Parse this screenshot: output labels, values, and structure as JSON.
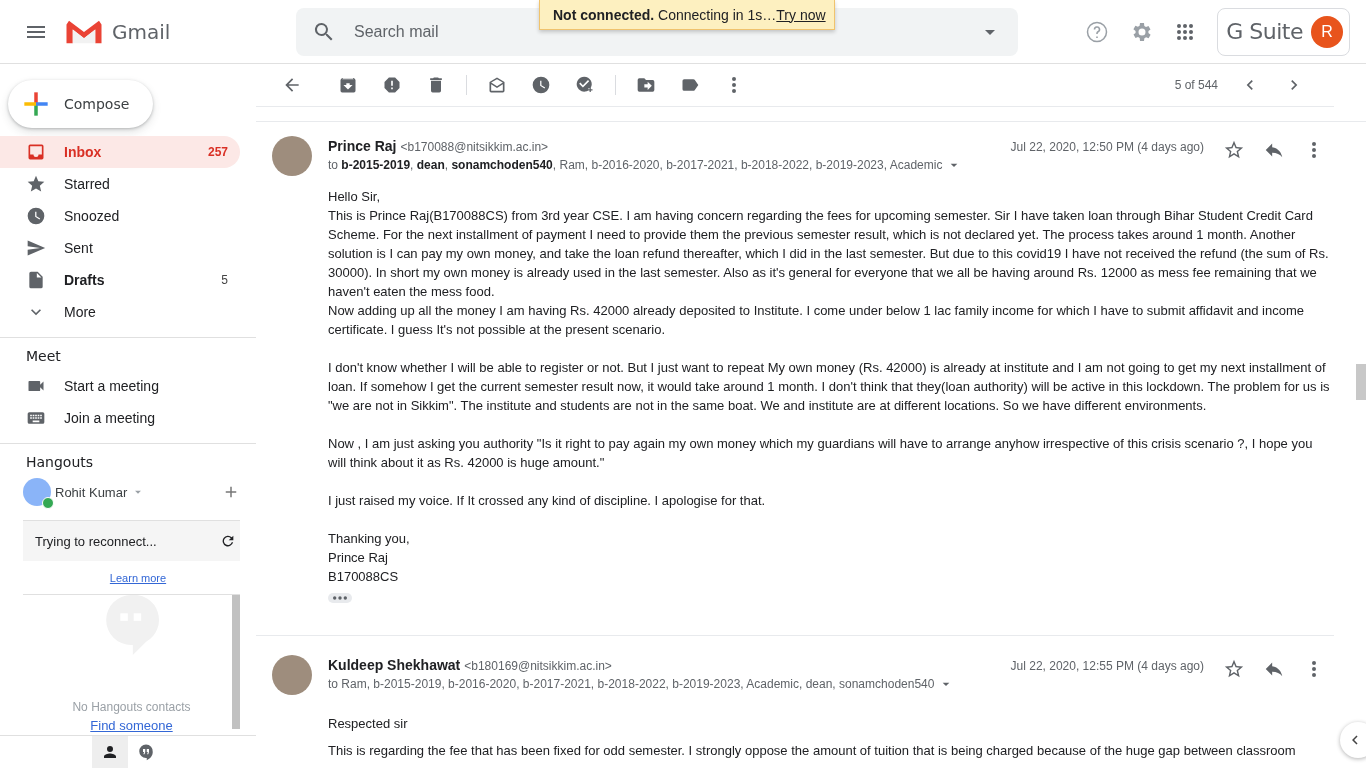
{
  "header": {
    "app_name": "Gmail",
    "search": {
      "placeholder": "Search mail"
    },
    "suite_label": "G Suite",
    "avatar_initial": "R"
  },
  "toast": {
    "message": "**Not connected.** Connecting in 1s…",
    "link": "Try now"
  },
  "compose": {
    "label": "Compose"
  },
  "sidebar": {
    "items": [
      {
        "label": "Inbox",
        "count": "257",
        "selected": true,
        "bold": true,
        "kind": "inbox"
      },
      {
        "label": "Starred",
        "selected": false,
        "bold": false,
        "kind": "star"
      },
      {
        "label": "Snoozed",
        "selected": false,
        "bold": false,
        "kind": "clock"
      },
      {
        "label": "Sent",
        "selected": false,
        "bold": false,
        "kind": "send"
      },
      {
        "label": "Drafts",
        "count": "5",
        "selected": false,
        "bold": true,
        "kind": "draft"
      },
      {
        "label": "More",
        "selected": false,
        "bold": false,
        "kind": "chevron"
      }
    ]
  },
  "meet": {
    "title": "Meet",
    "items": [
      {
        "label": "Start a meeting",
        "kind": "video"
      },
      {
        "label": "Join a meeting",
        "kind": "keyboard"
      }
    ]
  },
  "hangouts": {
    "title": "Hangouts",
    "user": "Rohit Kumar",
    "status": "Trying to reconnect...",
    "learn_more": "Learn more",
    "empty_text": "No Hangouts contacts",
    "find_link": "Find someone"
  },
  "toolbar": {
    "pager": "5 of 544"
  },
  "messages": [
    {
      "sender": "Prince Raj",
      "email": "<b170088@nitsikkim.ac.in>",
      "recipients": "to **b-2015-2019**, **dean**, **sonamchoden540**, Ram, b-2016-2020, b-2017-2021, b-2018-2022, b-2019-2023, Academic",
      "date": "Jul 22, 2020, 12:50 PM (4 days ago)",
      "blocks": [
        [
          "Hello Sir,",
          "This is Prince Raj(B170088CS) from 3rd year CSE. I am having concern regarding the fees for upcoming semester. Sir I have taken loan through Bihar Student Credit Card Scheme. For the next installment of payment I need to provide them the previous semester result, which is not declared yet. The process takes around 1 month. Another solution is I can pay my own money, and take the loan refund thereafter, which I did in the last semester. But due to this covid19 I have not received the refund (the sum of Rs. 30000). In short my own money is already used in the last semester. Also as it's general for everyone that we all be having around Rs. 12000 as mess fee remaining that we haven't eaten the mess food.",
          "Now adding up all the money I am having Rs. 42000 already deposited to Institute. I come under below 1 lac family income for which I have to submit affidavit and income certificate. I guess It's not possible at the present scenario."
        ],
        [
          "I don't know whether I will be able to register or not. But I just want to repeat My own money (Rs. 42000) is already at institute and I am not going to get my next installment of loan. If somehow I get the current semester result now, it would take around 1 month. I don't think that they(loan authority) will be active in this lockdown. The problem for us is \"we are not in Sikkim\". The institute and students are not in the same boat. We and institute are at different locations. So we have different environments."
        ],
        [
          "Now , I am just asking you authority \"Is it right to pay again my own money which my guardians will have to arrange anyhow irrespective of this crisis scenario ?, I hope you will think about it as Rs. 42000 is huge amount.\""
        ],
        [
          "I just raised my voice. If It crossed any kind of discipline. I apologise for that."
        ],
        [
          "Thanking you,",
          "Prince Raj",
          "B170088CS"
        ]
      ],
      "trimmed": true
    },
    {
      "sender": "Kuldeep Shekhawat",
      "email": "<b180169@nitsikkim.ac.in>",
      "recipients": "to Ram, b-2015-2019, b-2016-2020, b-2017-2021, b-2018-2022, b-2019-2023, Academic, dean, sonamchoden540",
      "date": "Jul 22, 2020, 12:55 PM (4 days ago)",
      "blocks": [
        [
          "Respected sir"
        ],
        [
          "This is regarding the fee that has been fixed for odd semester. I strongly oppose the amount of tuition that is being charged because of the huge gap between classroom"
        ]
      ],
      "trimmed": false
    }
  ]
}
